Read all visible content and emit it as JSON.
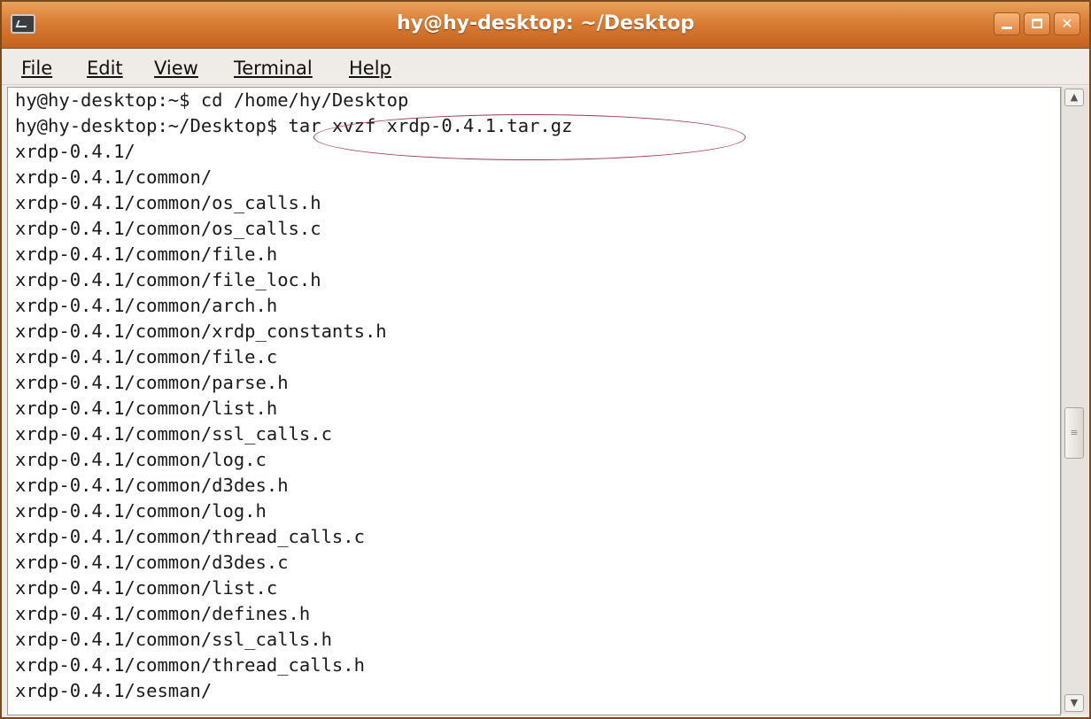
{
  "window": {
    "title": "hy@hy-desktop: ~/Desktop",
    "icon": "terminal-icon",
    "controls": [
      "minimize-icon",
      "maximize-icon",
      "close-icon"
    ]
  },
  "menubar": {
    "items": [
      {
        "label": "File",
        "mnemonic": "F"
      },
      {
        "label": "Edit",
        "mnemonic": "E"
      },
      {
        "label": "View",
        "mnemonic": "V"
      },
      {
        "label": "Terminal",
        "mnemonic": "T"
      },
      {
        "label": "Help",
        "mnemonic": "H"
      }
    ]
  },
  "terminal": {
    "lines": [
      "hy@hy-desktop:~$ cd /home/hy/Desktop",
      "hy@hy-desktop:~/Desktop$ tar xvzf xrdp-0.4.1.tar.gz",
      "xrdp-0.4.1/",
      "xrdp-0.4.1/common/",
      "xrdp-0.4.1/common/os_calls.h",
      "xrdp-0.4.1/common/os_calls.c",
      "xrdp-0.4.1/common/file.h",
      "xrdp-0.4.1/common/file_loc.h",
      "xrdp-0.4.1/common/arch.h",
      "xrdp-0.4.1/common/xrdp_constants.h",
      "xrdp-0.4.1/common/file.c",
      "xrdp-0.4.1/common/parse.h",
      "xrdp-0.4.1/common/list.h",
      "xrdp-0.4.1/common/ssl_calls.c",
      "xrdp-0.4.1/common/log.c",
      "xrdp-0.4.1/common/d3des.h",
      "xrdp-0.4.1/common/log.h",
      "xrdp-0.4.1/common/thread_calls.c",
      "xrdp-0.4.1/common/d3des.c",
      "xrdp-0.4.1/common/list.c",
      "xrdp-0.4.1/common/defines.h",
      "xrdp-0.4.1/common/ssl_calls.h",
      "xrdp-0.4.1/common/thread_calls.h",
      "xrdp-0.4.1/sesman/"
    ],
    "highlight_color": "#9c3b52"
  },
  "scrollbar": {
    "up_icon": "arrow-up-icon",
    "down_icon": "arrow-down-icon",
    "grip_icon": "grip-icon"
  }
}
